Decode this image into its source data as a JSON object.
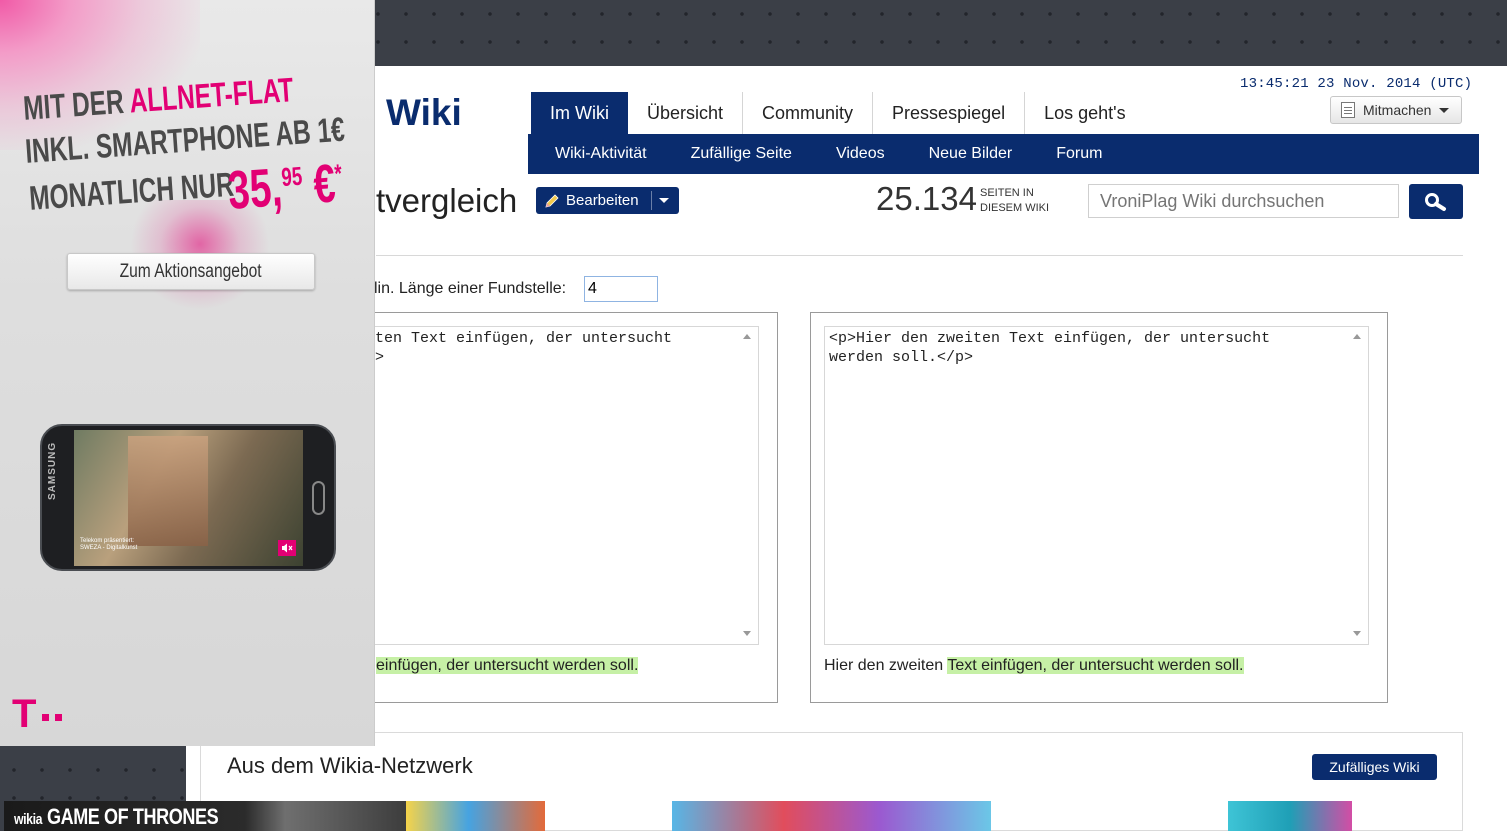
{
  "header": {
    "wiki_title": "Wiki",
    "timestamp": "13:45:21 23 Nov. 2014 (UTC)",
    "join_button": "Mitmachen"
  },
  "nav": {
    "tabs": [
      {
        "label": "Im Wiki",
        "active": true
      },
      {
        "label": "Übersicht",
        "active": false
      },
      {
        "label": "Community",
        "active": false
      },
      {
        "label": "Pressespiegel",
        "active": false
      },
      {
        "label": "Los geht's",
        "active": false
      }
    ],
    "subnav": [
      "Wiki-Aktivität",
      "Zufällige Seite",
      "Videos",
      "Neue Bilder",
      "Forum"
    ]
  },
  "page": {
    "title": "tvergleich",
    "edit_button": "Bearbeiten",
    "page_count": "25.134",
    "page_count_label_1": "SEITEN IN",
    "page_count_label_2": "DIESEM WIKI",
    "search_placeholder": "VroniPlag Wiki durchsuchen"
  },
  "compare": {
    "min_length_label": "lin. Länge einer Fundstelle:",
    "min_length_value": "4",
    "left_text": "ten Text einfügen, der untersucht\n>",
    "right_text": "<p>Hier den zweiten Text einfügen, der untersucht\nwerden soll.</p>",
    "left_result_highlight": "einfügen, der untersucht werden soll.",
    "right_result_plain": "Hier den zweiten ",
    "right_result_highlight": "Text einfügen, der untersucht werden soll."
  },
  "network": {
    "title": "Aus dem Wikia-Netzwerk",
    "random_button": "Zufälliges Wiki",
    "thumb_1_brand": "wikia",
    "thumb_1_title": "GAME OF THRONES"
  },
  "ad": {
    "line1_a": "MIT DER ",
    "line1_b": "ALLNET-FLAT",
    "line2": "INKL. SMARTPHONE AB 1€",
    "line3": "MONATLICH NUR",
    "price_main": "35,",
    "price_cents": "95",
    "price_tail": " €",
    "price_mark": "*",
    "cta": "Zum Aktionsangebot",
    "phone_brand": "SAMSUNG",
    "phone_credit_1": "Telekom präsentiert:",
    "phone_credit_2": "SWEZA - Digitalkunst",
    "logo_letter": "T"
  },
  "colors": {
    "brand_navy": "#0a2c6e",
    "highlight_green": "#c6f0a6",
    "telekom_magenta": "#e20074"
  },
  "icons": [
    "document-icon",
    "dropdown-caret-icon",
    "pencil-icon",
    "search-icon",
    "scroll-up-icon",
    "scroll-down-icon",
    "mute-icon"
  ]
}
